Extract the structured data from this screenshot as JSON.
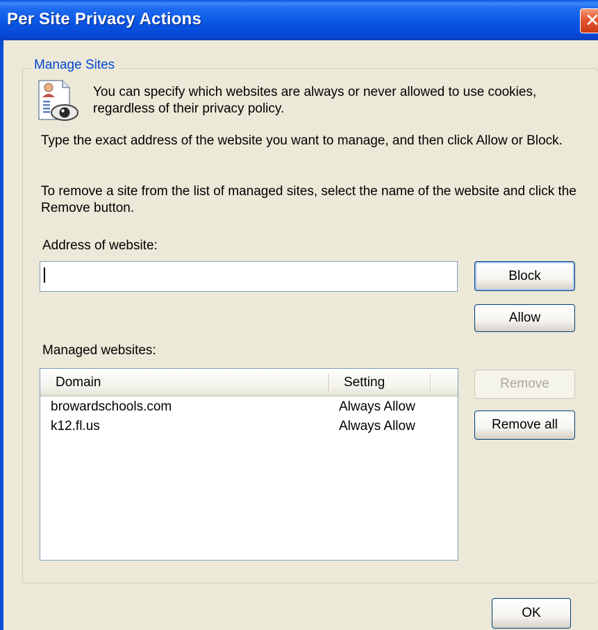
{
  "window": {
    "title": "Per Site Privacy Actions",
    "close_glyph": "✕"
  },
  "group": {
    "legend": "Manage Sites"
  },
  "info": {
    "icon": "privacy-document-eye-icon",
    "text": "You can specify which websites are always or never allowed to use cookies, regardless of their privacy policy."
  },
  "instructions": {
    "type_address": "Type the exact address of the website you want to manage, and then click Allow or Block.",
    "remove_site": "To remove a site from the list of managed sites, select the name of the website and click the Remove button."
  },
  "address": {
    "label": "Address of website:",
    "value": ""
  },
  "buttons": {
    "block": "Block",
    "allow": "Allow",
    "remove": "Remove",
    "remove_all": "Remove all",
    "ok": "OK"
  },
  "managed": {
    "label": "Managed websites:",
    "columns": {
      "domain": "Domain",
      "setting": "Setting"
    },
    "rows": [
      {
        "domain": "browardschools.com",
        "setting": "Always Allow"
      },
      {
        "domain": "k12.fl.us",
        "setting": "Always Allow"
      }
    ]
  },
  "colors": {
    "title_bar": "#0a56e3",
    "legend": "#0046d5",
    "dialog_bg": "#ece9d8"
  }
}
